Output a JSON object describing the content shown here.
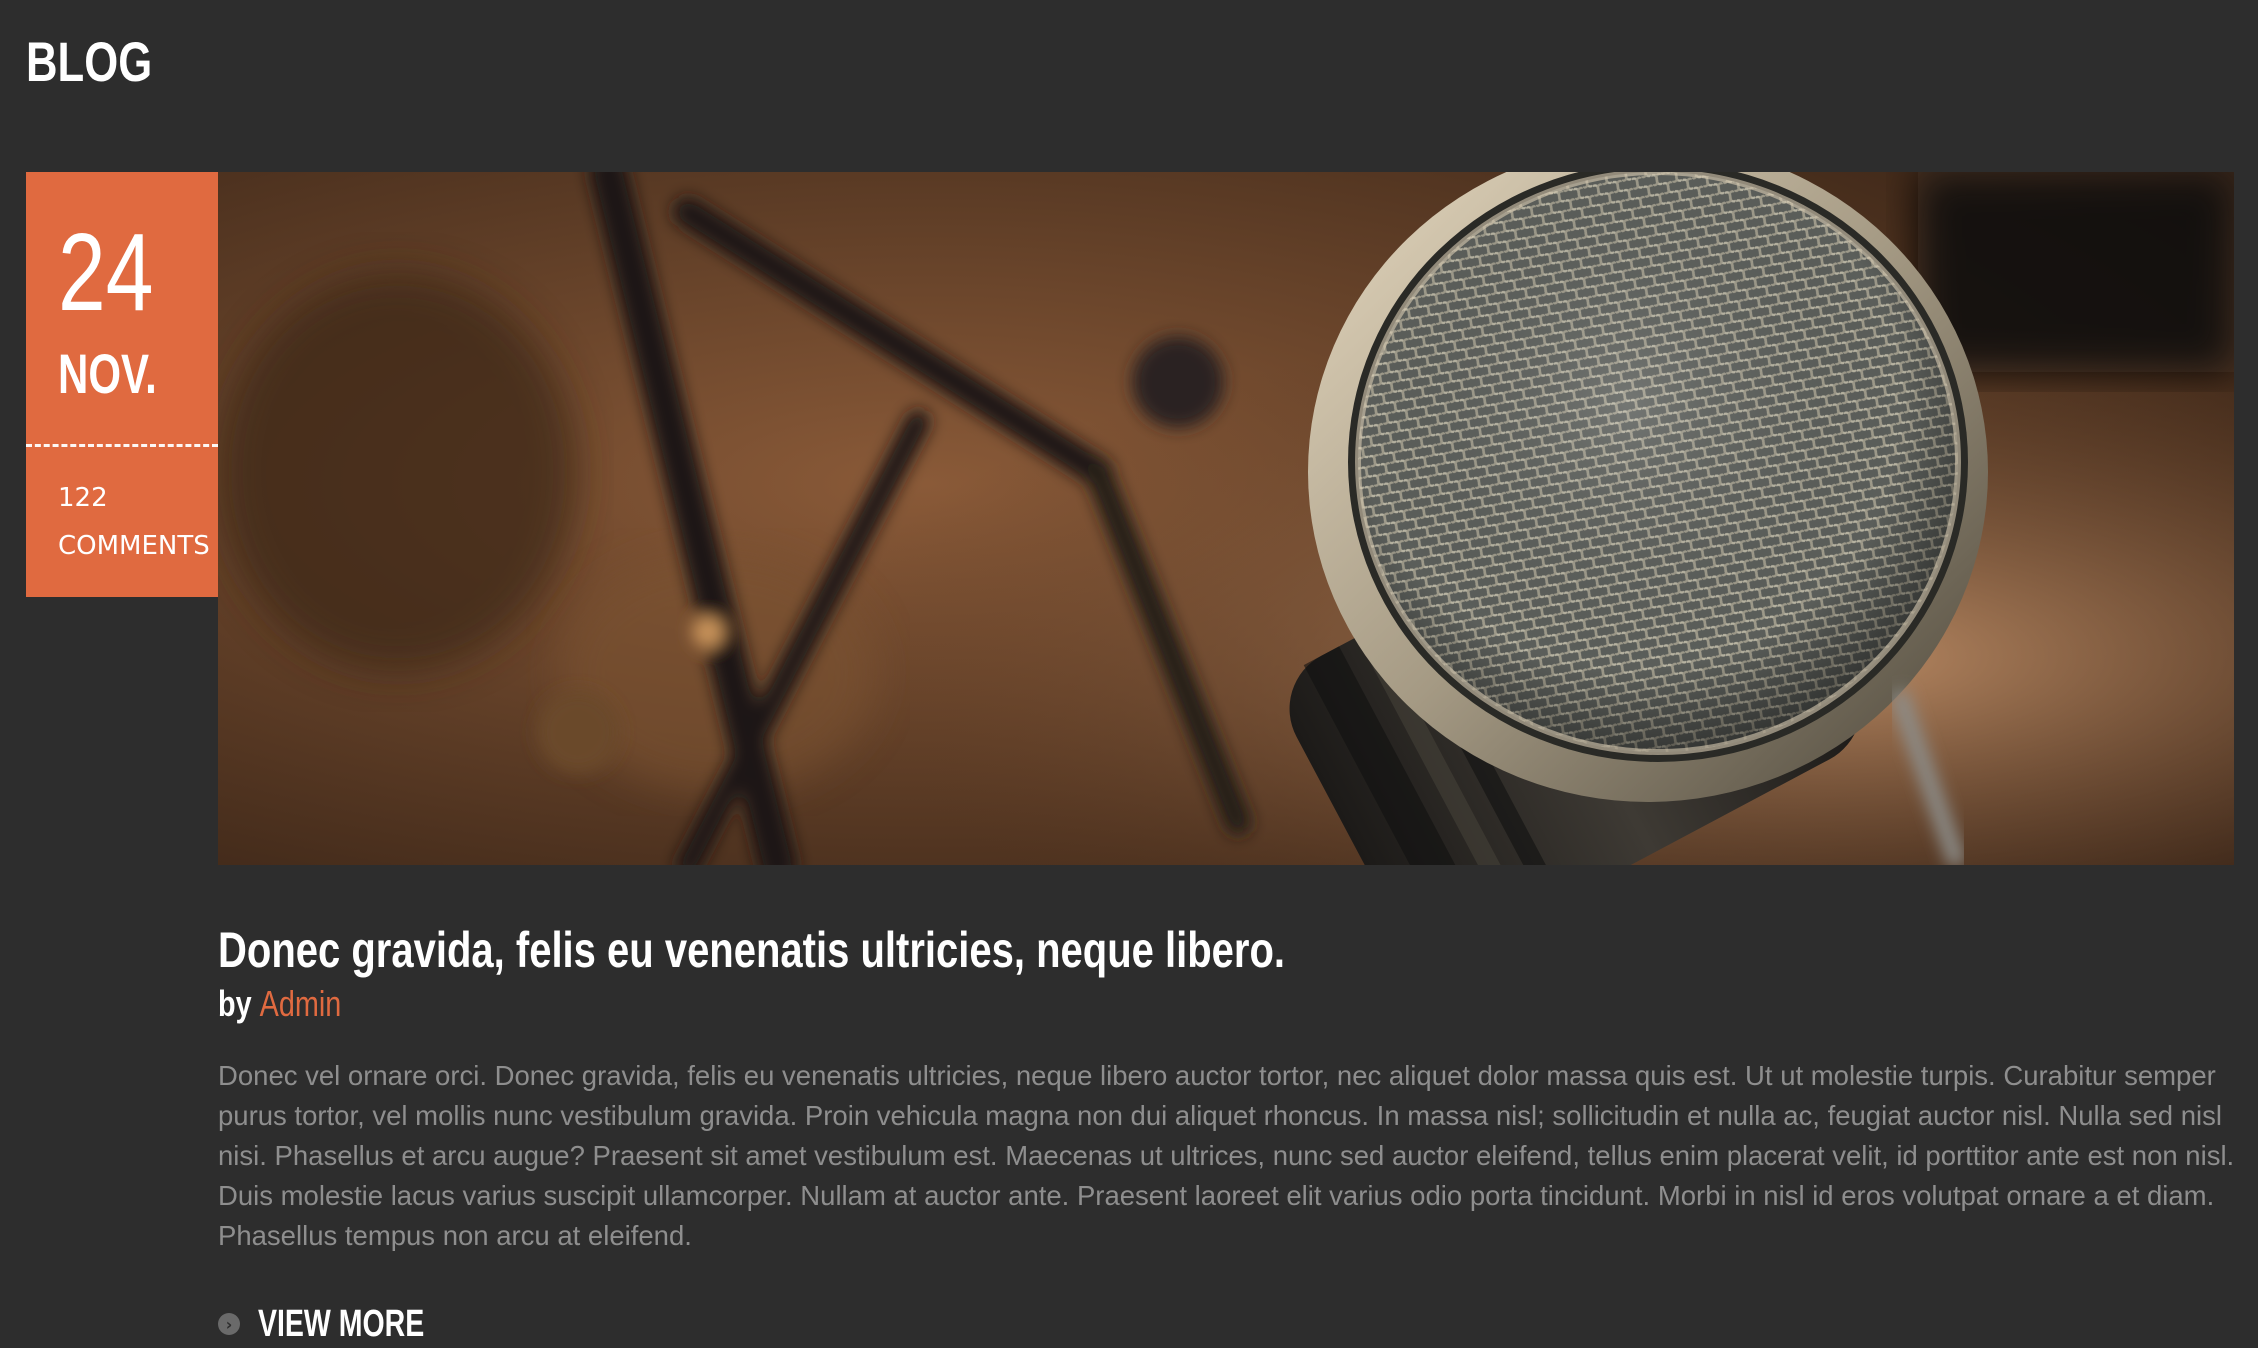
{
  "section": {
    "title": "BLOG"
  },
  "post": {
    "date": {
      "day": "24",
      "month": "NOV."
    },
    "comments": {
      "count": "122",
      "label": "COMMENTS"
    },
    "image": {
      "subject": "microphone-photo"
    },
    "title": "Donec gravida, felis eu venenatis ultricies, neque libero.",
    "byline": {
      "prefix": "by",
      "author": "Admin"
    },
    "excerpt": "Donec vel ornare orci. Donec gravida, felis eu venenatis ultricies, neque libero auctor tortor, nec aliquet dolor massa quis est. Ut ut molestie turpis. Curabitur semper purus tortor, vel mollis nunc vestibulum gravida. Proin vehicula magna non dui aliquet rhoncus. In massa nisl; sollicitudin et nulla ac, feugiat auctor nisl. Nulla sed nisl nisi. Phasellus et arcu augue? Praesent sit amet vestibulum est. Maecenas ut ultrices, nunc sed auctor eleifend, tellus enim placerat velit, id porttitor ante est non nisl. Duis molestie lacus varius suscipit ullamcorper. Nullam at auctor ante. Praesent laoreet elit varius odio porta tincidunt. Morbi in nisl id eros volutpat ornare a et diam. Phasellus tempus non arcu at eleifend.",
    "view_more": {
      "label": "VIEW MORE",
      "icon": "chevron-right-circle-icon"
    }
  },
  "colors": {
    "background": "#2d2d2d",
    "accent": "#e06a40",
    "text": "#ffffff",
    "muted_text": "#8e8e8e"
  }
}
